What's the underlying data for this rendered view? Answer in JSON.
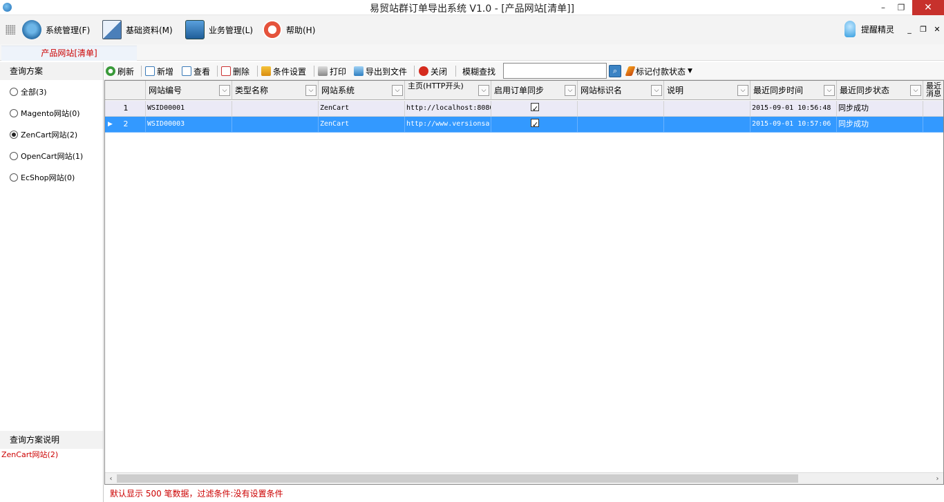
{
  "window": {
    "title": "易贸站群订单导出系统 V1.0 - [产品网站[清单]]",
    "minimize": "–",
    "restore": "❐",
    "close": "✕"
  },
  "menu": {
    "items": [
      {
        "label": "系统管理(F)",
        "icon": "gear-fish-icon"
      },
      {
        "label": "基础资料(M)",
        "icon": "document-edit-icon"
      },
      {
        "label": "业务管理(L)",
        "icon": "monitor-icon"
      },
      {
        "label": "帮助(H)",
        "icon": "lifebuoy-icon"
      }
    ],
    "reminder": "提醒精灵",
    "mdi_min": "_",
    "mdi_restore": "❐",
    "mdi_close": "✕"
  },
  "doc_tab": "产品网站[清单]",
  "left_panel": {
    "header": "查询方案",
    "options": [
      {
        "label": "全部(3)",
        "checked": false
      },
      {
        "label": "Magento网站(0)",
        "checked": false
      },
      {
        "label": "ZenCart网站(2)",
        "checked": true
      },
      {
        "label": "OpenCart网站(1)",
        "checked": false
      },
      {
        "label": "EcShop网站(0)",
        "checked": false
      }
    ],
    "desc_header": "查询方案说明",
    "desc_text": "ZenCart网站(2)"
  },
  "toolbar": {
    "refresh": "刷新",
    "add": "新增",
    "view": "查看",
    "delete": "删除",
    "condition": "条件设置",
    "print": "打印",
    "export": "导出到文件",
    "close": "关闭",
    "search_label": "模糊查找",
    "search_value": "",
    "mark_payment": "标记付款状态"
  },
  "grid": {
    "columns": [
      "网站编号",
      "类型名称",
      "网站系统",
      "主页(HTTP开头)",
      "启用订单同步",
      "网站标识名",
      "说明",
      "最近同步时间",
      "最近同步状态",
      "最近消息"
    ],
    "rows": [
      {
        "num": "1",
        "id": "WSID00001",
        "type": "",
        "system": "ZenCart",
        "home": "http://localhost:8080",
        "sync": true,
        "ident": "",
        "note": "",
        "time": "2015-09-01 10:56:48",
        "status": "同步成功",
        "selected": false
      },
      {
        "num": "2",
        "id": "WSID00003",
        "type": "",
        "system": "ZenCart",
        "home": "http://www.versionsa",
        "sync": true,
        "ident": "",
        "note": "",
        "time": "2015-09-01 10:57:06",
        "status": "同步成功",
        "selected": true
      }
    ]
  },
  "status": "默认显示 500 笔数据，过滤条件:没有设置条件"
}
